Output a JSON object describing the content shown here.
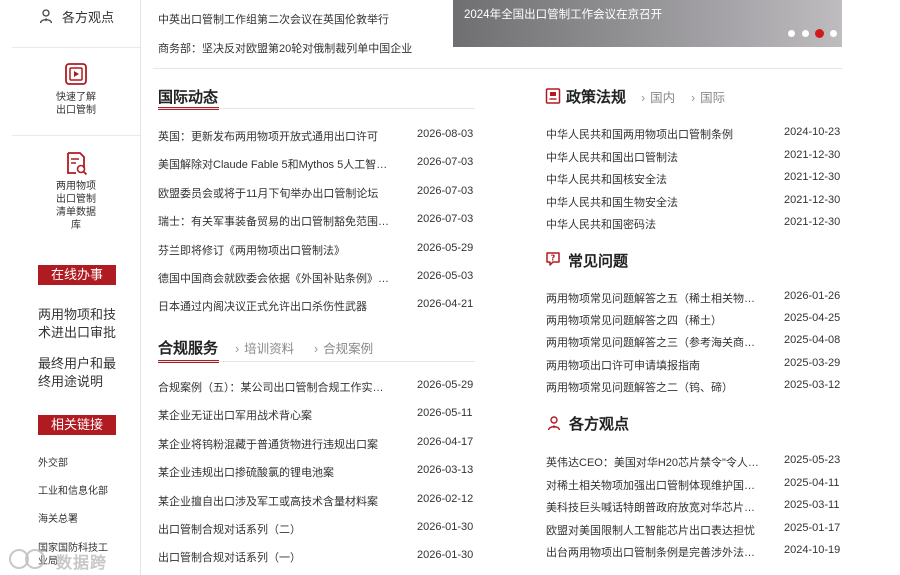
{
  "sidebar": {
    "top_item": "各方观点",
    "quick_intro": [
      "快速了解",
      "出口管制"
    ],
    "dual_use_list": [
      "两用物项",
      "出口管制",
      "清单数据",
      "库"
    ],
    "online_badge": "在线办事",
    "online_links": [
      [
        "两用物项和技",
        "术进出口审批"
      ],
      [
        "最终用户和最",
        "终用途说明"
      ]
    ],
    "related_badge": "相关链接",
    "related_links": [
      "外交部",
      "工业和信息化部",
      "海关总署",
      "国家国防科技工",
      "业局"
    ]
  },
  "top_news": [
    "中英出口管制工作组第二次会议在英国伦敦举行",
    "商务部：坚决反对欧盟第20轮对俄制裁列单中国企业"
  ],
  "banner": {
    "caption": "2024年全国出口管制工作会议在京召开",
    "slide_count": 4,
    "active_slide": 3
  },
  "intl_news": {
    "title": "国际动态",
    "items": [
      {
        "title": "英国：更新发布两用物项开放式通用出口许可",
        "date": "2026-08-03"
      },
      {
        "title": "美国解除对Claude Fable 5和Mythos 5人工智能…",
        "date": "2026-07-03"
      },
      {
        "title": "欧盟委员会或将于11月下旬举办出口管制论坛",
        "date": "2026-07-03"
      },
      {
        "title": "瑞士：有关军事装备贸易的出口管制豁免范围…",
        "date": "2026-07-03"
      },
      {
        "title": "芬兰即将修订《两用物项出口管制法》",
        "date": "2026-05-29"
      },
      {
        "title": "德国中国商会就欧委会依据《外国补贴条例》…",
        "date": "2026-05-03"
      },
      {
        "title": "日本通过内阁决议正式允许出口杀伤性武器",
        "date": "2026-04-21"
      }
    ]
  },
  "compliance": {
    "title": "合规服务",
    "tabs": [
      "培训资料",
      "合规案例"
    ],
    "items": [
      {
        "title": "合规案例（五）：某公司出口管制合规工作实…",
        "date": "2026-05-29"
      },
      {
        "title": "某企业无证出口军用战术背心案",
        "date": "2026-05-11"
      },
      {
        "title": "某企业将钨粉混藏于普通货物进行违规出口案",
        "date": "2026-04-17"
      },
      {
        "title": "某企业违规出口掺硫酸氯的锂电池案",
        "date": "2026-03-13"
      },
      {
        "title": "某企业擅自出口涉及军工或高技术含量材料案",
        "date": "2026-02-12"
      },
      {
        "title": "出口管制合规对话系列（二）",
        "date": "2026-01-30"
      },
      {
        "title": "出口管制合规对话系列（一）",
        "date": "2026-01-30"
      }
    ]
  },
  "policy": {
    "title": "政策法规",
    "tabs": [
      "国内",
      "国际"
    ],
    "items": [
      {
        "title": "中华人民共和国两用物项出口管制条例",
        "date": "2024-10-23"
      },
      {
        "title": "中华人民共和国出口管制法",
        "date": "2021-12-30"
      },
      {
        "title": "中华人民共和国核安全法",
        "date": "2021-12-30"
      },
      {
        "title": "中华人民共和国生物安全法",
        "date": "2021-12-30"
      },
      {
        "title": "中华人民共和国密码法",
        "date": "2021-12-30"
      }
    ]
  },
  "faq": {
    "title": "常见问题",
    "items": [
      {
        "title": "两用物项常见问题解答之五（稀土相关物…",
        "date": "2026-01-26"
      },
      {
        "title": "两用物项常见问题解答之四（稀土）",
        "date": "2025-04-25"
      },
      {
        "title": "两用物项常见问题解答之三（参考海关商…",
        "date": "2025-04-08"
      },
      {
        "title": "两用物项出口许可申请填报指南",
        "date": "2025-03-29"
      },
      {
        "title": "两用物项常见问题解答之二（钨、碲）",
        "date": "2025-03-12"
      }
    ]
  },
  "views": {
    "title": "各方观点",
    "items": [
      {
        "title": "英伟达CEO：美国对华H20芯片禁令\"令人…",
        "date": "2025-05-23"
      },
      {
        "title": "对稀土相关物项加强出口管制体现维护国…",
        "date": "2025-04-11"
      },
      {
        "title": "美科技巨头喊话特朗普政府放宽对华芯片…",
        "date": "2025-03-11"
      },
      {
        "title": "欧盟对美国限制人工智能芯片出口表达担忧",
        "date": "2025-01-17"
      },
      {
        "title": "出台两用物项出口管制条例是完善涉外法…",
        "date": "2024-10-19"
      }
    ]
  },
  "watermark": {
    "text": "数据跨境"
  },
  "colors": {
    "accent": "#b01b22",
    "text": "#333333",
    "muted": "#888888"
  }
}
